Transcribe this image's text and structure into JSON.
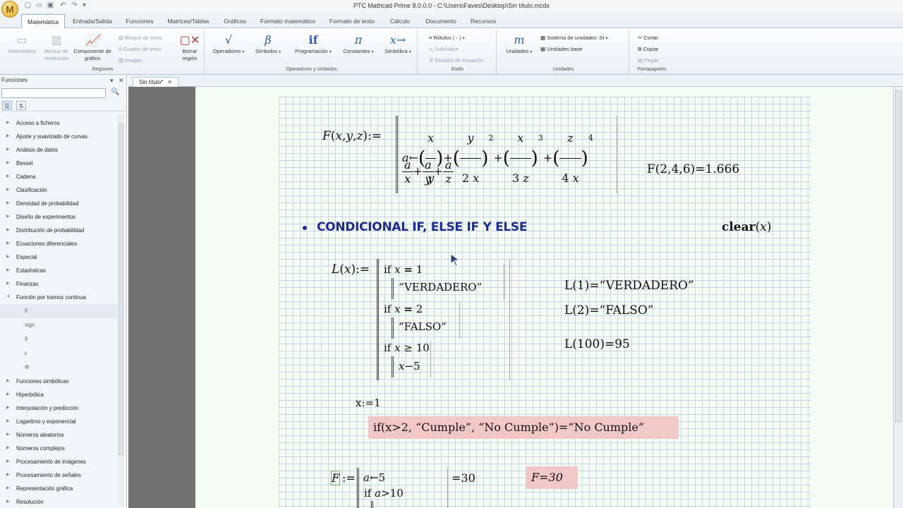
{
  "window": {
    "title": "PTC Mathcad Prime 8.0.0.0 - C:\\Users\\Faves\\Desktop\\Sin título.mcdx",
    "logo": "M"
  },
  "tabs": [
    "Matemática",
    "Entrada/Salida",
    "Funciones",
    "Matrices/Tablas",
    "Gráficos",
    "Formato matemático",
    "Formato de texto",
    "Cálculo",
    "Documento",
    "Recursos"
  ],
  "ribbon": {
    "regiones": {
      "label": "Regiones",
      "matematica": "Matemática",
      "bloque": "Bloque de resolución",
      "componente": "Componente de gráfico",
      "bloque_texto": "Bloque de texto",
      "cuadro_texto": "Cuadro de texto",
      "imagen": "Imagen",
      "borrar": "Borrar región"
    },
    "operadores": {
      "label": "Operadores y símbolos",
      "operadores": "Operadores",
      "simbolos": "Símbolos",
      "programacion": "Programación",
      "constantes": "Constantes",
      "simbolica": "Simbólica"
    },
    "estilo": {
      "label": "Estilo",
      "rotulos": "Rótulos",
      "rotulos_val": "( - )",
      "subindice": "Subíndice",
      "division": "División de ecuación"
    },
    "unidades": {
      "label": "Unidades",
      "unidades": "Unidades",
      "sistema": "Sistema de unidades:",
      "sistema_val": "SI",
      "base": "Unidades base"
    },
    "portapapeles": {
      "label": "Portapapeles",
      "cortar": "Cortar",
      "copiar": "Copiar",
      "pegar": "Pegar"
    }
  },
  "icons": {
    "operadores": "√",
    "simbolos": "β",
    "programacion": "if",
    "constantes": "π",
    "simbolica": "x→",
    "unidades": "m"
  },
  "panel": {
    "title": "Funciones",
    "categories": [
      "Acceso a ficheros",
      "Ajuste y suavizado de curvas",
      "Análisis de datos",
      "Bessel",
      "Cadena",
      "Clasificación",
      "Densidad de probabilidad",
      "Diseño de experimentos",
      "Distribución de probabilidad",
      "Ecuaciones diferenciales",
      "Especial",
      "Estadísticas",
      "Finanzas",
      "Función por tramos continua"
    ],
    "subitems": [
      "if",
      "sign",
      "δ",
      "ε",
      "Φ"
    ],
    "categories2": [
      "Funciones simbólicas",
      "Hiperbólica",
      "Interpolación y predicción",
      "Logaritmo y exponencial",
      "Números aleatorios",
      "Números complejos",
      "Procesamiento de imágenes",
      "Procesamiento de señales",
      "Representación gráfica",
      "Resolución"
    ]
  },
  "doc": {
    "tab": "Sin título*"
  },
  "math": {
    "F_result": "F(2,4,6)=1.666",
    "heading": "CONDICIONAL IF, ELSE IF Y ELSE",
    "clear": "clear",
    "L_results": [
      "L(1)=“VERDADERO”",
      "L(2)=“FALSO”",
      "L(100)=95"
    ],
    "strings": {
      "verdadero": "“VERDADERO”",
      "falso": "“FALSO”",
      "cumple": "“Cumple”",
      "nocumple": "“No Cumple”"
    },
    "x_assign": "x:=1",
    "if_expr": "if(x>2, “Cumple”, “No Cumple”)=“No Cumple”",
    "F2_value": "=30",
    "F2_result": "F=30"
  }
}
